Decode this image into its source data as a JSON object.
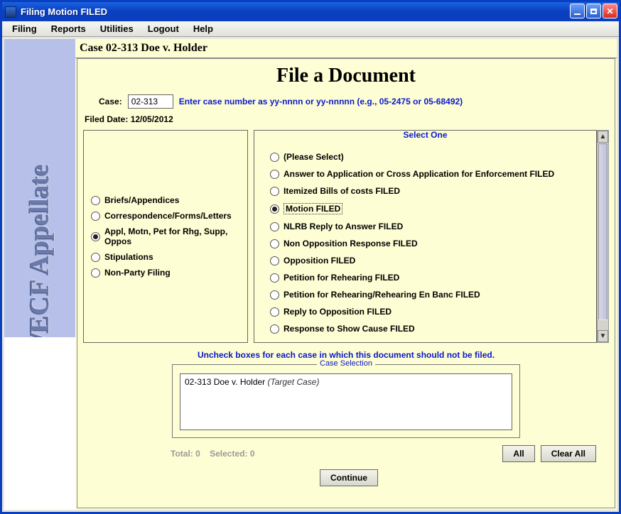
{
  "window": {
    "title": "Filing Motion FILED"
  },
  "menu": {
    "items": [
      "Filing",
      "Reports",
      "Utilities",
      "Logout",
      "Help"
    ]
  },
  "sidebar": {
    "brand": "CM/ECF Appellate"
  },
  "case_header": "Case 02-313 Doe v. Holder",
  "form": {
    "title": "File a Document",
    "case_label": "Case:",
    "case_value": "02-313",
    "case_instructions": "Enter case number as yy-nnnn or yy-nnnnn (e.g., 05-2475 or 05-68492)",
    "filed_date_label": "Filed Date:",
    "filed_date_value": "12/05/2012"
  },
  "categories": [
    {
      "label": "Briefs/Appendices",
      "selected": false
    },
    {
      "label": "Correspondence/Forms/Letters",
      "selected": false
    },
    {
      "label": "Appl, Motn, Pet for Rhg, Supp, Oppos",
      "selected": true
    },
    {
      "label": "Stipulations",
      "selected": false
    },
    {
      "label": "Non-Party Filing",
      "selected": false
    }
  ],
  "options_legend": "Select One",
  "options": [
    {
      "label": "(Please Select)",
      "selected": false
    },
    {
      "label": "Answer to Application or Cross Application for Enforcement FILED",
      "selected": false
    },
    {
      "label": "Itemized Bills of costs FILED",
      "selected": false
    },
    {
      "label": "Motion FILED",
      "selected": true
    },
    {
      "label": "NLRB Reply to Answer FILED",
      "selected": false
    },
    {
      "label": "Non Opposition Response FILED",
      "selected": false
    },
    {
      "label": "Opposition FILED",
      "selected": false
    },
    {
      "label": "Petition for Rehearing FILED",
      "selected": false
    },
    {
      "label": "Petition for Rehearing/Rehearing En Banc FILED",
      "selected": false
    },
    {
      "label": "Reply to Opposition FILED",
      "selected": false
    },
    {
      "label": "Response to Show Cause FILED",
      "selected": false
    }
  ],
  "case_selection": {
    "instruction": "Uncheck boxes for each case in which this document should not be filed.",
    "legend": "Case Selection",
    "item_case": "02-313 Doe v. Holder",
    "item_note": "(Target Case)",
    "total_label": "Total: 0",
    "selected_label": "Selected: 0"
  },
  "buttons": {
    "all": "All",
    "clear_all": "Clear All",
    "continue": "Continue"
  }
}
